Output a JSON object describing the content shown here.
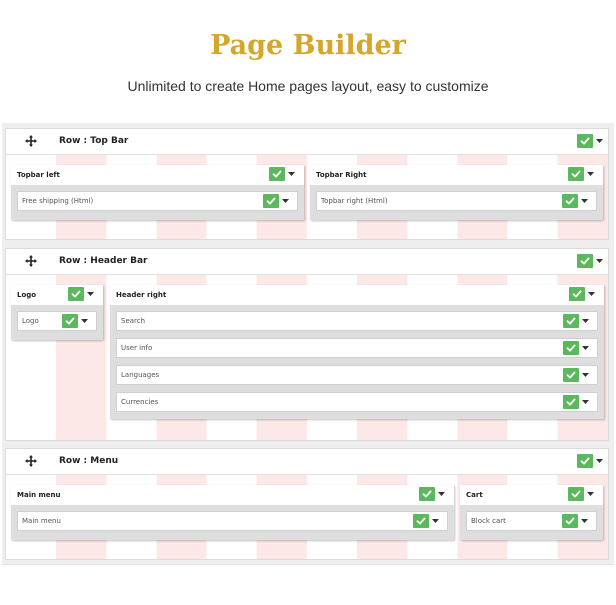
{
  "header": {
    "title": "Page Builder",
    "subtitle": "Unlimited to create Home pages layout, easy to customize"
  },
  "rows": [
    {
      "title": "Row : Top Bar",
      "columns": [
        {
          "title": "Topbar left",
          "blocks": [
            "Free shipping (Html)"
          ]
        },
        {
          "title": "Topbar Right",
          "blocks": [
            "Topbar right (Html)"
          ]
        }
      ]
    },
    {
      "title": "Row : Header Bar",
      "columns": [
        {
          "title": "Logo",
          "blocks": [
            "Logo"
          ]
        },
        {
          "title": "Header right",
          "blocks": [
            "Search",
            "User info",
            "Languages",
            "Currencies"
          ]
        }
      ]
    },
    {
      "title": "Row : Menu",
      "columns": [
        {
          "title": "Main menu",
          "blocks": [
            "Main menu"
          ]
        },
        {
          "title": "Cart",
          "blocks": [
            "Block cart"
          ]
        }
      ]
    }
  ],
  "icons": {
    "move": "move-icon",
    "check": "check-icon",
    "caret": "caret-down-icon"
  },
  "colors": {
    "title": "#d4a62a",
    "check": "#5cb85c",
    "grid_stripe": "#fde8e8"
  }
}
